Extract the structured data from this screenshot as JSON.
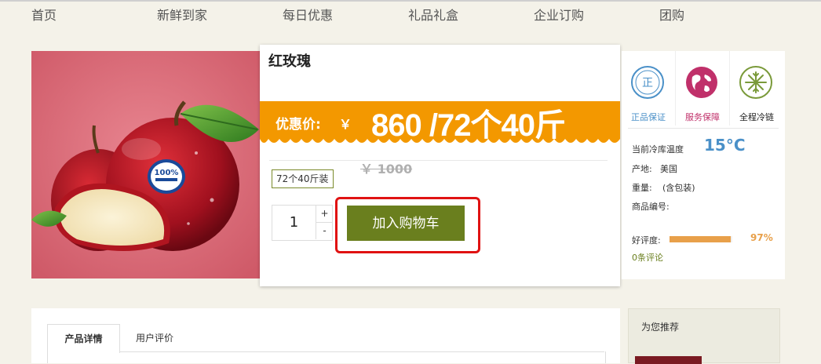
{
  "nav": {
    "items": [
      "首页",
      "新鲜到家",
      "每日优惠",
      "礼品礼盒",
      "企业订购",
      "团购"
    ]
  },
  "product": {
    "title": "红玫瑰",
    "price_label": "优惠价:",
    "currency": "￥",
    "price": "860 /72个40斤",
    "original_price": "￥ 1000",
    "spec": "72个40斤装",
    "sticker": "100%"
  },
  "quantity": {
    "value": "1",
    "plus": "+",
    "minus": "-"
  },
  "cart": {
    "add_label": "加入购物车"
  },
  "services": [
    {
      "label": "正品保证",
      "icon": "genuine-icon",
      "color": "#4a90c8"
    },
    {
      "label": "服务保障",
      "icon": "globe-icon",
      "color": "#c0306a"
    },
    {
      "label": "全程冷链",
      "icon": "snowflake-icon",
      "color": "#7a9a3a"
    }
  ],
  "details": {
    "temp_label": "当前冷库温度",
    "temp_value": "15°C",
    "origin_label": "产地:",
    "origin_value": "美国",
    "weight_label": "重量:",
    "weight_value": "(含包装)",
    "code_label": "商品编号:",
    "rating_label": "好评度:",
    "rating_value": "97%",
    "rating_fraction": 0.97,
    "reviews": "0条评论"
  },
  "tabs": [
    {
      "label": "产品详情",
      "active": true
    },
    {
      "label": "用户评价",
      "active": false
    }
  ],
  "recommend": {
    "title": "为您推荐"
  },
  "colors": {
    "accent_green": "#6a7f1e",
    "price_orange": "#f39800",
    "highlight_red": "#e01212",
    "temp_blue": "#4a90c8",
    "rating_orange": "#e8a04a"
  }
}
